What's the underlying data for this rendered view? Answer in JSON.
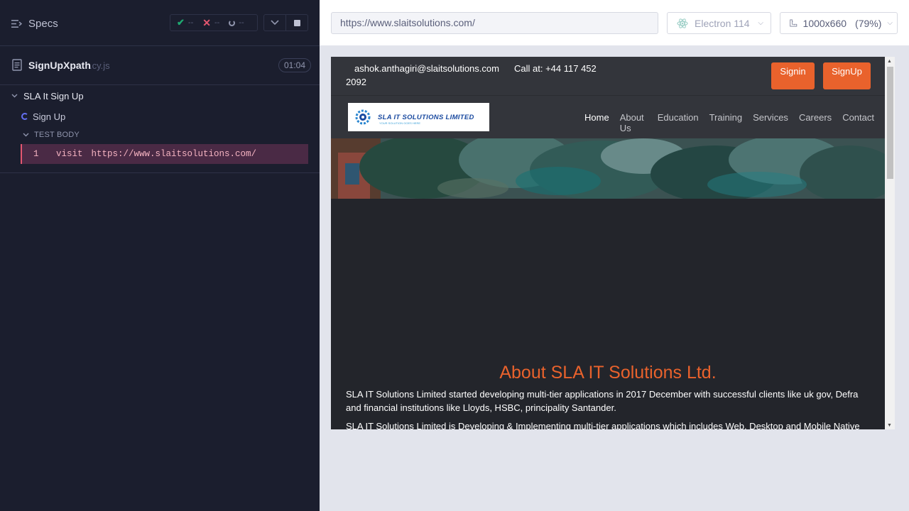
{
  "runner": {
    "specs_label": "Specs",
    "stats": {
      "passed": "--",
      "failed": "--",
      "pending": "--"
    },
    "spec_file": {
      "name": "SignUpXpath",
      "ext": ".cy.js",
      "duration": "01:04"
    },
    "suite_title": "SLA It Sign Up",
    "test_title": "Sign Up",
    "test_body_label": "TEST BODY",
    "command": {
      "number": "1",
      "name": "visit",
      "message": "https://www.slaitsolutions.com/"
    }
  },
  "browser": {
    "url": "https://www.slaitsolutions.com/",
    "name": "Electron 114",
    "viewport": "1000x660",
    "scale": "(79%)"
  },
  "site": {
    "email": "ashok.anthagiri@slaitsolutions.com",
    "phone_line1": "Call at: +44 117 452",
    "phone_line2": "2092",
    "signin_label": "Signin",
    "signup_label": "SignUp",
    "logo_text": "SLA IT SOLUTIONS LIMITED",
    "logo_tagline": "YOUR SOLUTION GOES HERE",
    "nav": [
      "Home",
      "About Us",
      "Education",
      "Training",
      "Services",
      "Careers",
      "Contact"
    ],
    "about_title": "About SLA IT Solutions Ltd.",
    "about_p1": "SLA IT Solutions Limited started developing multi-tier applications in 2017 December with successful clients like uk gov, Defra and financial institutions like Lloyds, HSBC, principality Santander.",
    "about_p2": "SLA IT Solutions Limited is Developing & Implementing multi-tier applications which includes Web, Desktop and Mobile Native"
  },
  "colors": {
    "accent": "#e9622c",
    "runner_bg": "#1b1e2e",
    "fail": "#e45770",
    "pass": "#1fa971"
  }
}
